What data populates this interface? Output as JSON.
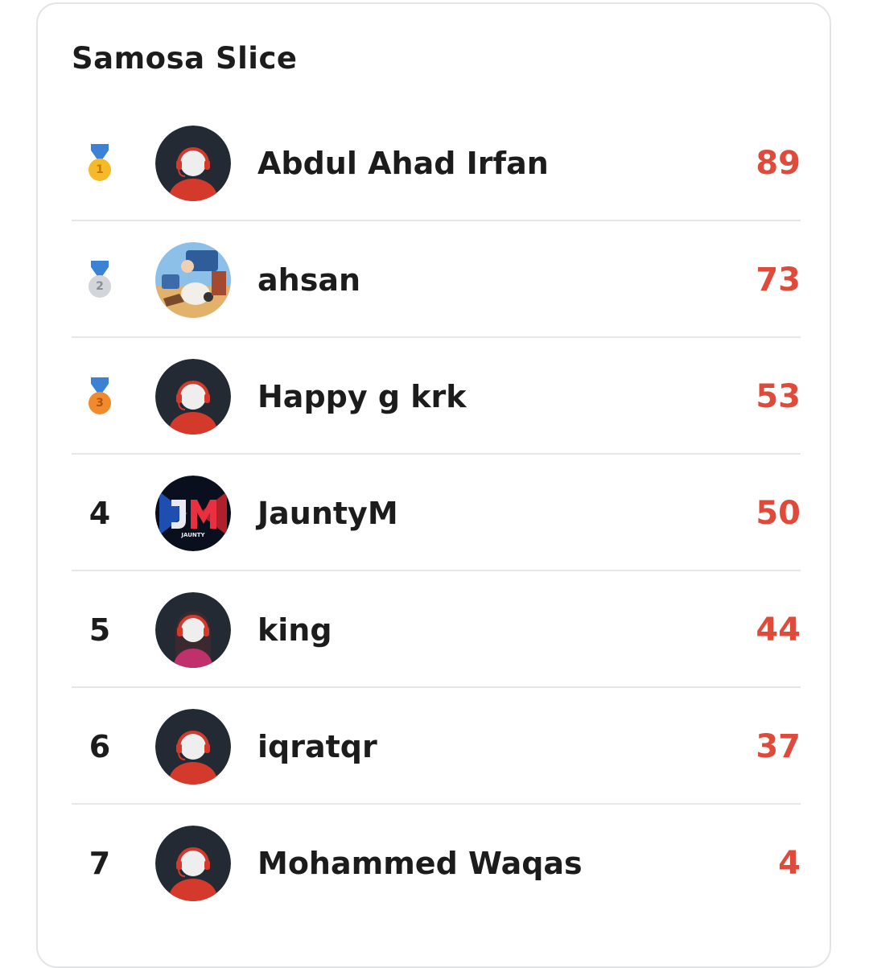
{
  "leaderboard": {
    "title": "Samosa Slice",
    "colors": {
      "score": "#e04a3a",
      "gold": "#f6b928",
      "silver": "#d2d5d9",
      "bronze": "#ef8b2c"
    },
    "entries": [
      {
        "rank": "1",
        "medal": "gold-medal-icon",
        "name": "Abdul Ahad Irfan",
        "score": "89",
        "avatar": "default-headset-avatar"
      },
      {
        "rank": "2",
        "medal": "silver-medal-icon",
        "name": "ahsan",
        "score": "73",
        "avatar": "photo-avatar"
      },
      {
        "rank": "3",
        "medal": "bronze-medal-icon",
        "name": "Happy g krk",
        "score": "53",
        "avatar": "default-headset-avatar"
      },
      {
        "rank": "4",
        "name": "JauntyM",
        "score": "50",
        "avatar": "jm-logo-avatar"
      },
      {
        "rank": "5",
        "name": "king",
        "score": "44",
        "avatar": "hijab-headset-avatar"
      },
      {
        "rank": "6",
        "name": "iqratqr",
        "score": "37",
        "avatar": "default-headset-avatar"
      },
      {
        "rank": "7",
        "name": "Mohammed Waqas",
        "score": "4",
        "avatar": "default-headset-avatar"
      }
    ]
  }
}
